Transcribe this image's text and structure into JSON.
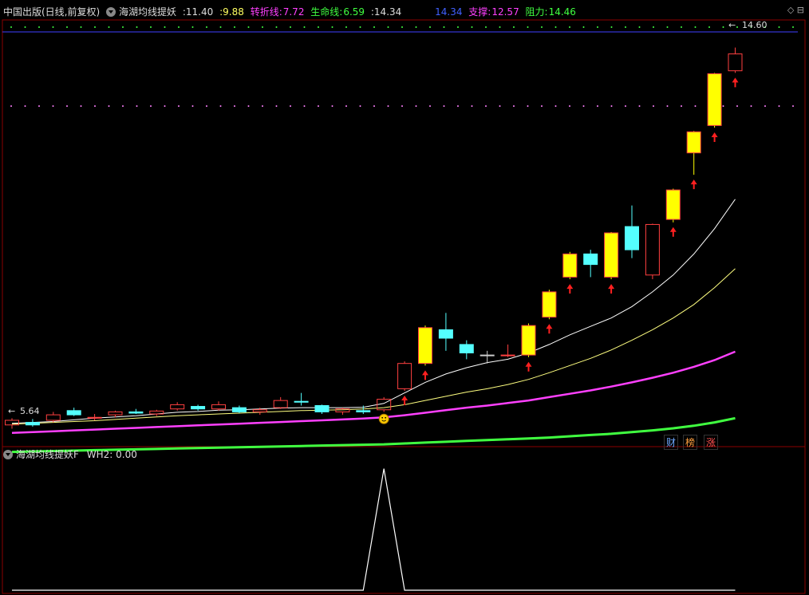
{
  "header": {
    "title": "中国出版(日线,前复权)",
    "indicator": "海湖均线提妖",
    "v1": ":11.40",
    "v2": ":9.88",
    "zhuanzhe_label": "转折线:",
    "zhuanzhe_value": "7.72",
    "shengming_label": "生命线:",
    "shengming_value": "6.59",
    "v3": ":14.34",
    "v4": "14.34",
    "zhicheng_label": "支撑:",
    "zhicheng_value": "12.57",
    "zuli_label": "阻力:",
    "zuli_value": "14.46"
  },
  "sub_header": {
    "indicator": "海湖均线提妖F",
    "wh2_label": "WH2:",
    "wh2_value": "0.00"
  },
  "labels": {
    "high_label": "14.60",
    "low_label": "5.64",
    "badge_cai": "财",
    "badge_bang": "榜",
    "badge_zhang": "涨",
    "smiley": "☺"
  },
  "colors": {
    "up_candle": "#ff4040",
    "down_candle": "#54ffff",
    "yellow_candle": "#ffff00",
    "ma_white": "#ffffff",
    "ma_yellow": "#ffff80",
    "ma_magenta": "#ff40ff",
    "ma_green": "#40ff40",
    "arrow": "#ff2020",
    "top_line": "#4040ff"
  },
  "chart_data": {
    "type": "candlestick",
    "ylim": [
      5.2,
      15.2
    ],
    "candles": [
      {
        "o": 5.64,
        "h": 5.8,
        "l": 5.55,
        "c": 5.75,
        "t": "up"
      },
      {
        "o": 5.7,
        "h": 5.78,
        "l": 5.6,
        "c": 5.64,
        "t": "down"
      },
      {
        "o": 5.75,
        "h": 5.95,
        "l": 5.7,
        "c": 5.88,
        "t": "up"
      },
      {
        "o": 5.98,
        "h": 6.05,
        "l": 5.85,
        "c": 5.88,
        "t": "down"
      },
      {
        "o": 5.8,
        "h": 5.9,
        "l": 5.75,
        "c": 5.82,
        "t": "up"
      },
      {
        "o": 5.88,
        "h": 5.98,
        "l": 5.82,
        "c": 5.95,
        "t": "up"
      },
      {
        "o": 5.95,
        "h": 6.02,
        "l": 5.9,
        "c": 5.92,
        "t": "down"
      },
      {
        "o": 5.9,
        "h": 6.0,
        "l": 5.85,
        "c": 5.97,
        "t": "up"
      },
      {
        "o": 6.02,
        "h": 6.18,
        "l": 5.98,
        "c": 6.12,
        "t": "up"
      },
      {
        "o": 6.08,
        "h": 6.12,
        "l": 5.98,
        "c": 6.02,
        "t": "down"
      },
      {
        "o": 6.02,
        "h": 6.2,
        "l": 5.98,
        "c": 6.12,
        "t": "up"
      },
      {
        "o": 6.05,
        "h": 6.1,
        "l": 5.92,
        "c": 5.95,
        "t": "down"
      },
      {
        "o": 5.95,
        "h": 6.05,
        "l": 5.88,
        "c": 6.0,
        "t": "up"
      },
      {
        "o": 6.05,
        "h": 6.3,
        "l": 6.02,
        "c": 6.22,
        "t": "up"
      },
      {
        "o": 6.2,
        "h": 6.4,
        "l": 6.1,
        "c": 6.18,
        "t": "down"
      },
      {
        "o": 6.1,
        "h": 6.12,
        "l": 5.9,
        "c": 5.95,
        "t": "down"
      },
      {
        "o": 5.95,
        "h": 6.05,
        "l": 5.88,
        "c": 6.02,
        "t": "up"
      },
      {
        "o": 5.95,
        "h": 6.1,
        "l": 5.9,
        "c": 5.98,
        "t": "down"
      },
      {
        "o": 6.0,
        "h": 6.3,
        "l": 5.95,
        "c": 6.25,
        "t": "up"
      },
      {
        "o": 6.5,
        "h": 7.15,
        "l": 6.45,
        "c": 7.1,
        "t": "up"
      },
      {
        "o": 7.1,
        "h": 8.0,
        "l": 7.05,
        "c": 7.95,
        "t": "yellow"
      },
      {
        "o": 7.9,
        "h": 8.3,
        "l": 7.4,
        "c": 7.7,
        "t": "down"
      },
      {
        "o": 7.55,
        "h": 7.65,
        "l": 7.2,
        "c": 7.35,
        "t": "down"
      },
      {
        "o": 7.3,
        "h": 7.4,
        "l": 7.1,
        "c": 7.3,
        "t": "flat"
      },
      {
        "o": 7.3,
        "h": 7.55,
        "l": 7.25,
        "c": 7.3,
        "t": "up"
      },
      {
        "o": 7.3,
        "h": 8.05,
        "l": 7.25,
        "c": 8.0,
        "t": "yellow"
      },
      {
        "o": 8.2,
        "h": 8.85,
        "l": 8.15,
        "c": 8.8,
        "t": "yellow"
      },
      {
        "o": 9.15,
        "h": 9.75,
        "l": 9.1,
        "c": 9.7,
        "t": "yellow"
      },
      {
        "o": 9.7,
        "h": 9.8,
        "l": 9.15,
        "c": 9.45,
        "t": "down"
      },
      {
        "o": 9.15,
        "h": 10.22,
        "l": 9.1,
        "c": 10.2,
        "t": "yellow"
      },
      {
        "o": 10.35,
        "h": 10.85,
        "l": 9.6,
        "c": 9.8,
        "t": "down"
      },
      {
        "o": 9.2,
        "h": 10.42,
        "l": 9.1,
        "c": 10.4,
        "t": "up"
      },
      {
        "o": 10.52,
        "h": 11.25,
        "l": 10.45,
        "c": 11.22,
        "t": "yellow"
      },
      {
        "o": 12.1,
        "h": 12.62,
        "l": 11.58,
        "c": 12.6,
        "t": "yellow"
      },
      {
        "o": 12.75,
        "h": 14.0,
        "l": 12.7,
        "c": 13.98,
        "t": "yellow"
      },
      {
        "o": 14.05,
        "h": 14.6,
        "l": 14.0,
        "c": 14.45,
        "t": "up"
      }
    ],
    "ma_white": [
      5.68,
      5.7,
      5.72,
      5.76,
      5.8,
      5.83,
      5.86,
      5.9,
      5.94,
      5.96,
      5.99,
      6.0,
      6.02,
      6.04,
      6.05,
      6.05,
      6.05,
      6.06,
      6.15,
      6.4,
      6.65,
      6.85,
      7.0,
      7.12,
      7.2,
      7.35,
      7.55,
      7.78,
      7.98,
      8.18,
      8.45,
      8.8,
      9.2,
      9.7,
      10.3,
      11.0
    ],
    "ma_yellow": [
      5.66,
      5.68,
      5.7,
      5.72,
      5.74,
      5.77,
      5.8,
      5.83,
      5.86,
      5.88,
      5.9,
      5.92,
      5.94,
      5.96,
      5.98,
      5.99,
      6.0,
      6.02,
      6.05,
      6.12,
      6.22,
      6.32,
      6.42,
      6.5,
      6.6,
      6.72,
      6.88,
      7.05,
      7.22,
      7.42,
      7.65,
      7.9,
      8.18,
      8.5,
      8.9,
      9.35
    ],
    "ma_magenta": [
      5.45,
      5.47,
      5.49,
      5.51,
      5.53,
      5.55,
      5.57,
      5.59,
      5.61,
      5.63,
      5.65,
      5.67,
      5.69,
      5.71,
      5.73,
      5.75,
      5.77,
      5.79,
      5.82,
      5.87,
      5.93,
      5.99,
      6.05,
      6.1,
      6.16,
      6.22,
      6.3,
      6.38,
      6.46,
      6.55,
      6.65,
      6.76,
      6.88,
      7.02,
      7.18,
      7.38
    ],
    "ma_green": [
      5.0,
      5.01,
      5.02,
      5.03,
      5.04,
      5.05,
      5.06,
      5.07,
      5.08,
      5.09,
      5.1,
      5.11,
      5.12,
      5.13,
      5.14,
      5.15,
      5.16,
      5.17,
      5.18,
      5.2,
      5.22,
      5.24,
      5.26,
      5.28,
      5.3,
      5.32,
      5.34,
      5.37,
      5.4,
      5.43,
      5.47,
      5.51,
      5.56,
      5.62,
      5.7,
      5.8
    ],
    "arrows": [
      19,
      20,
      25,
      26,
      27,
      29,
      32,
      33,
      34,
      35
    ],
    "smiley_index": 18,
    "sub_series": [
      0,
      0,
      0,
      0,
      0,
      0,
      0,
      0,
      0,
      0,
      0,
      0,
      0,
      0,
      0,
      0,
      0,
      0,
      1,
      0,
      0,
      0,
      0,
      0,
      0,
      0,
      0,
      0,
      0,
      0,
      0,
      0,
      0,
      0,
      0,
      0
    ],
    "sub_ylim": [
      0,
      1.05
    ]
  }
}
